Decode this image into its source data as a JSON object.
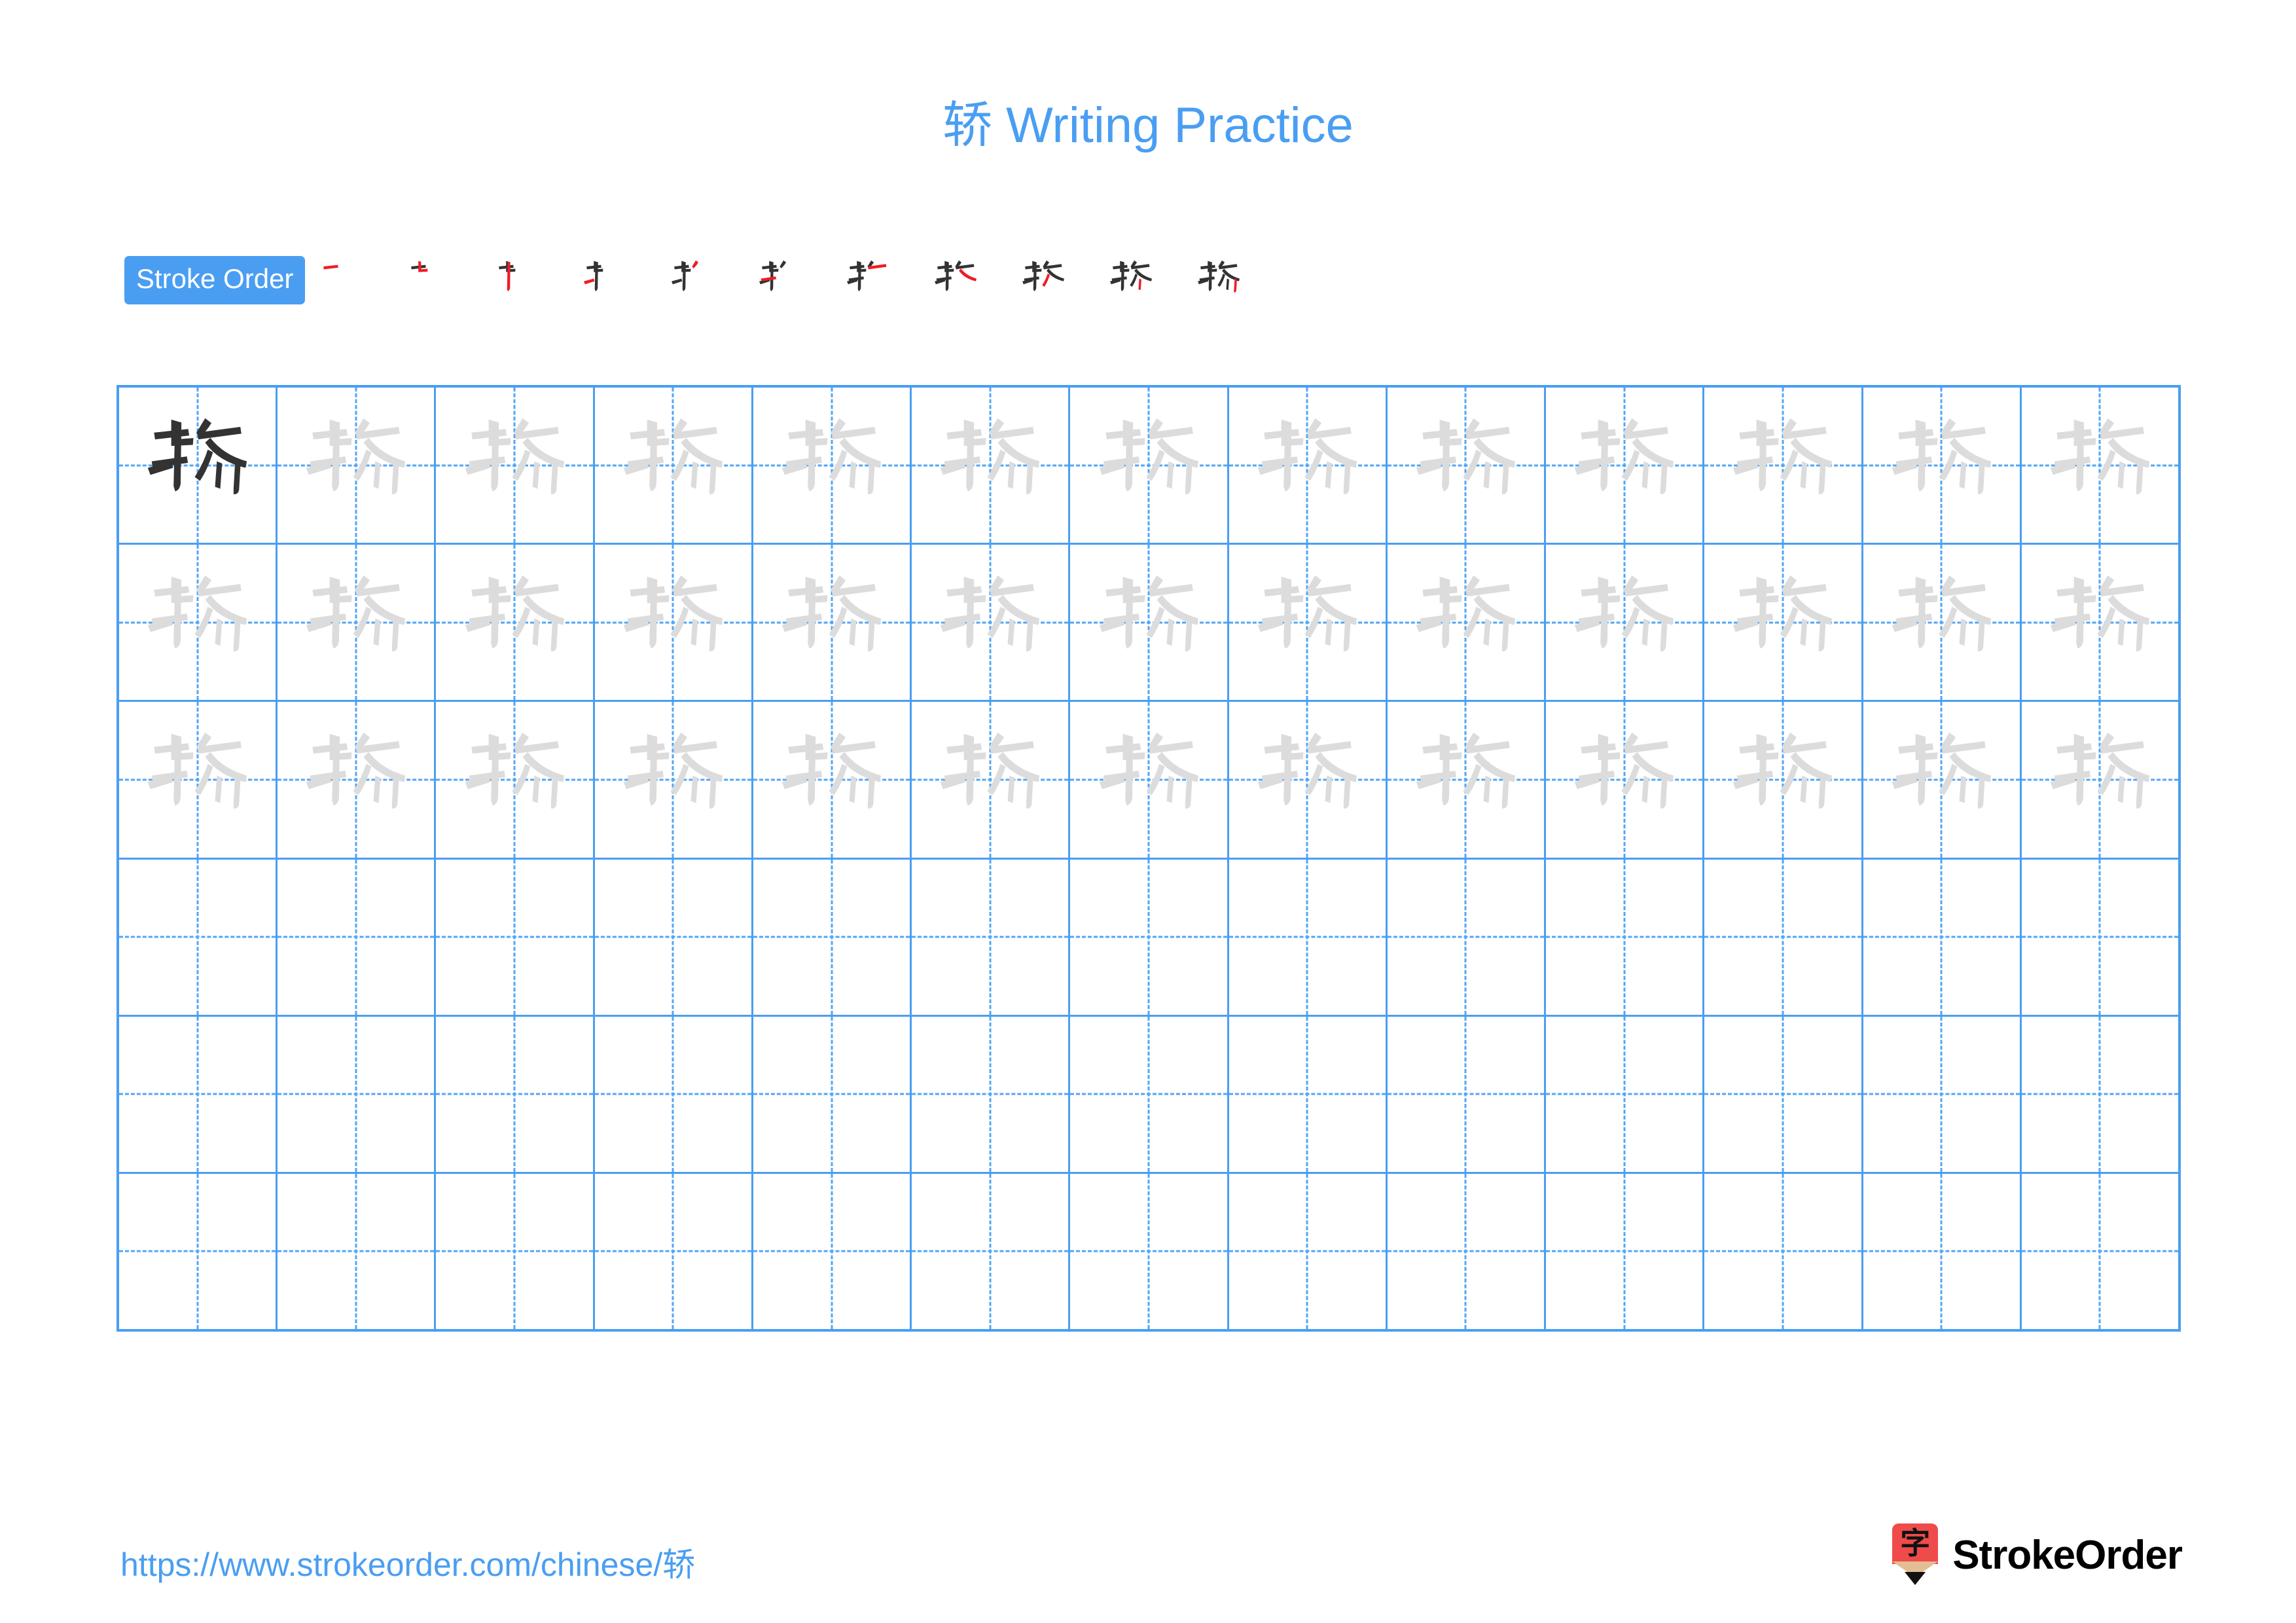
{
  "page": {
    "character": "轿",
    "title": "轿 Writing Practice",
    "accent_color": "#4a9ef2",
    "stroke_highlight_color": "#ee1c25",
    "ink_color": "#333333",
    "trace_color": "#dcdcdc"
  },
  "stroke_order": {
    "badge_label": "Stroke Order",
    "total_strokes": 11,
    "steps": [
      {
        "index": 1,
        "strokes_shown": 1,
        "new_stroke": "heng"
      },
      {
        "index": 2,
        "strokes_shown": 2,
        "new_stroke": "shu-zhe-zhe"
      },
      {
        "index": 3,
        "strokes_shown": 3,
        "new_stroke": "shu"
      },
      {
        "index": 4,
        "strokes_shown": 4,
        "new_stroke": "pie"
      },
      {
        "index": 5,
        "strokes_shown": 5,
        "new_stroke": "dian"
      },
      {
        "index": 6,
        "strokes_shown": 6,
        "new_stroke": "heng"
      },
      {
        "index": 7,
        "strokes_shown": 7,
        "new_stroke": "pie"
      },
      {
        "index": 8,
        "strokes_shown": 8,
        "new_stroke": "na"
      },
      {
        "index": 9,
        "strokes_shown": 9,
        "new_stroke": "pie"
      },
      {
        "index": 10,
        "strokes_shown": 10,
        "new_stroke": "shu"
      },
      {
        "index": 11,
        "strokes_shown": 11,
        "new_stroke": "shu-gou"
      }
    ]
  },
  "practice_grid": {
    "columns": 13,
    "rows": 6,
    "rows_detail": [
      {
        "row": 1,
        "style": "first-dark-then-trace"
      },
      {
        "row": 2,
        "style": "trace"
      },
      {
        "row": 3,
        "style": "trace"
      },
      {
        "row": 4,
        "style": "blank"
      },
      {
        "row": 5,
        "style": "blank"
      },
      {
        "row": 6,
        "style": "blank"
      }
    ]
  },
  "footer": {
    "url": "https://www.strokeorder.com/chinese/轿",
    "brand": "StrokeOrder",
    "logo_glyph": "字"
  }
}
